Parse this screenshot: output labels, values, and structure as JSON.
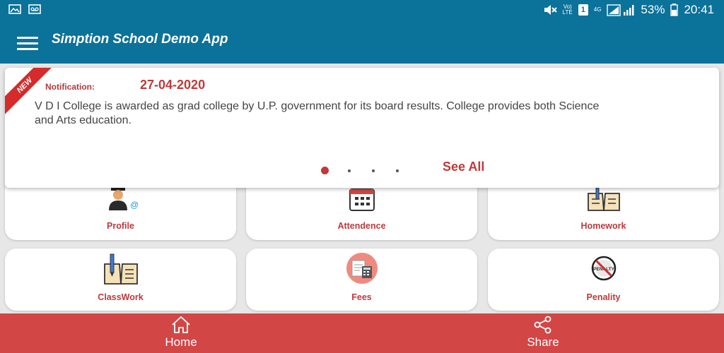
{
  "status_bar": {
    "volte": "Vo)",
    "lte": "LTE",
    "sim": "1",
    "network": "4G",
    "battery": "53%",
    "time": "20:41",
    "icons": [
      "image-icon",
      "voicemail-icon",
      "mute-icon",
      "signal-icon",
      "battery-icon"
    ]
  },
  "app_bar": {
    "title": "Simption School Demo App",
    "color": "#0b729a"
  },
  "notification": {
    "badge": "NEW",
    "label": "Notification:",
    "date": "27-04-2020",
    "text": "V D I College is awarded as  grad college by U.P. government for its board results. College provides both Science and Arts education.",
    "see_all": "See All",
    "pager": {
      "total": 4,
      "active": 1
    }
  },
  "menu": [
    {
      "label": "Profile",
      "icon": "student-profile-icon"
    },
    {
      "label": "Attendence",
      "icon": "calendar-icon"
    },
    {
      "label": "Homework",
      "icon": "book-icon"
    },
    {
      "label": "ClassWork",
      "icon": "open-book-pencil-icon"
    },
    {
      "label": "Fees",
      "icon": "fees-calculator-icon"
    },
    {
      "label": "Penality",
      "icon": "penalty-icon"
    }
  ],
  "penalty_icon_text": "PENALTY",
  "bottom_nav": {
    "home": "Home",
    "share": "Share",
    "color": "#d24646"
  }
}
